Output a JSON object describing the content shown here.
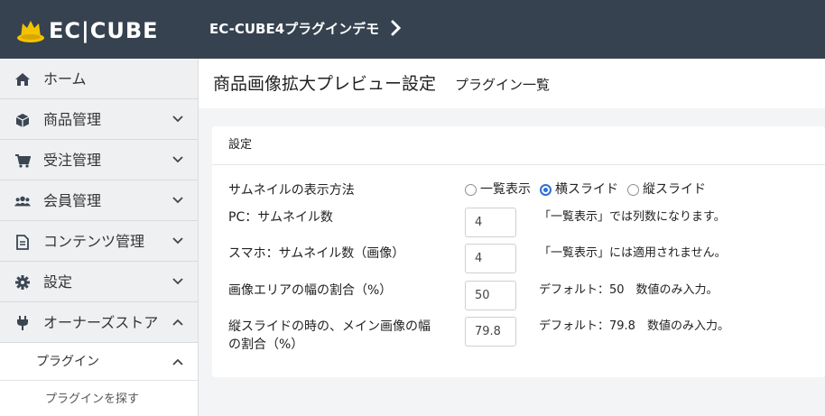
{
  "header": {
    "logo_text": "EC|CUBE",
    "shop_name": "EC-CUBE4プラグインデモ",
    "colors": {
      "bar": "#36424f",
      "logo_accent": "#f3c300"
    }
  },
  "sidebar": {
    "items": [
      {
        "label": "ホーム",
        "icon": "home-icon"
      },
      {
        "label": "商品管理",
        "icon": "cube-icon"
      },
      {
        "label": "受注管理",
        "icon": "cart-icon"
      },
      {
        "label": "会員管理",
        "icon": "users-icon"
      },
      {
        "label": "コンテンツ管理",
        "icon": "file-icon"
      },
      {
        "label": "設定",
        "icon": "gear-icon"
      },
      {
        "label": "オーナーズストア",
        "icon": "plug-icon"
      }
    ],
    "sub": {
      "label": "プラグイン"
    },
    "subsub": {
      "label": "プラグインを探す"
    }
  },
  "main": {
    "title": "商品画像拡大プレビュー設定",
    "subtitle": "プラグイン一覧",
    "card": {
      "header": "設定",
      "fields": {
        "display_method": {
          "label": "サムネイルの表示方法",
          "options": [
            "一覧表示",
            "横スライド",
            "縦スライド"
          ],
          "selected": "横スライド"
        },
        "pc_thumbs": {
          "label": "PC：サムネイル数",
          "value": "4",
          "help": "「一覧表示」では列数になります。"
        },
        "sp_thumbs": {
          "label": "スマホ：サムネイル数（画像）",
          "value": "4",
          "help": "「一覧表示」には適用されません。"
        },
        "area_ratio": {
          "label": "画像エリアの幅の割合（%）",
          "value": "50",
          "help": "デフォルト：50　数値のみ入力。"
        },
        "vertical_ratio": {
          "label_line1": "縦スライドの時の、メイン画像の幅",
          "label_line2": "の割合（%）",
          "value": "79.8",
          "help": "デフォルト：79.8　数値のみ入力。"
        }
      }
    }
  }
}
